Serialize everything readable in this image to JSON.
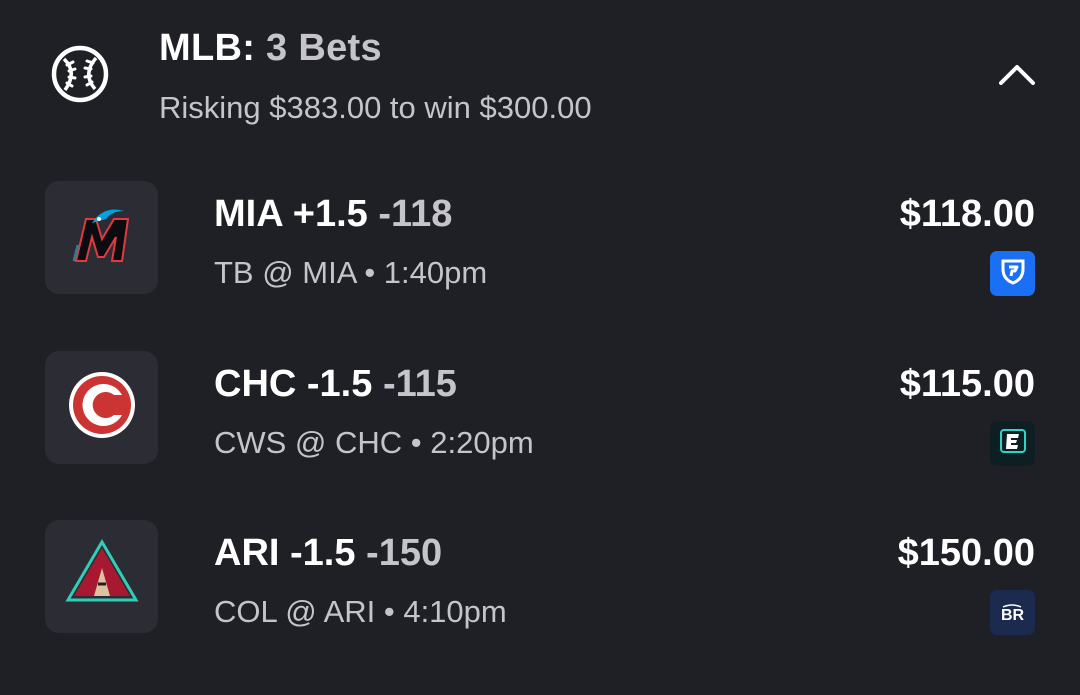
{
  "header": {
    "sport": "MLB:",
    "count": "3 Bets",
    "subtitle": "Risking $383.00 to win $300.00",
    "icon": "baseball-icon",
    "collapse_icon": "chevron-up-icon"
  },
  "bets": [
    {
      "team_logo": "marlins-logo",
      "selection": "MIA +1.5",
      "odds": "-118",
      "matchup": "TB @ MIA • 1:40pm",
      "amount": "$118.00",
      "book_icon": "fanduel-icon",
      "book_color": "#1b6ff2"
    },
    {
      "team_logo": "cubs-logo",
      "selection": "CHC -1.5",
      "odds": "-115",
      "matchup": "CWS @ CHC • 2:20pm",
      "amount": "$115.00",
      "book_icon": "espn-bet-icon",
      "book_color": "#0e1f24"
    },
    {
      "team_logo": "diamondbacks-logo",
      "selection": "ARI -1.5",
      "odds": "-150",
      "matchup": "COL @ ARI • 4:10pm",
      "amount": "$150.00",
      "book_icon": "betrivers-icon",
      "book_color": "#1a2b4f",
      "book_text": "BR"
    }
  ],
  "colors": {
    "background": "#1f1f26",
    "tile": "#2c2c34",
    "muted_text": "#c4c4ca",
    "primary_text": "#ffffff"
  }
}
